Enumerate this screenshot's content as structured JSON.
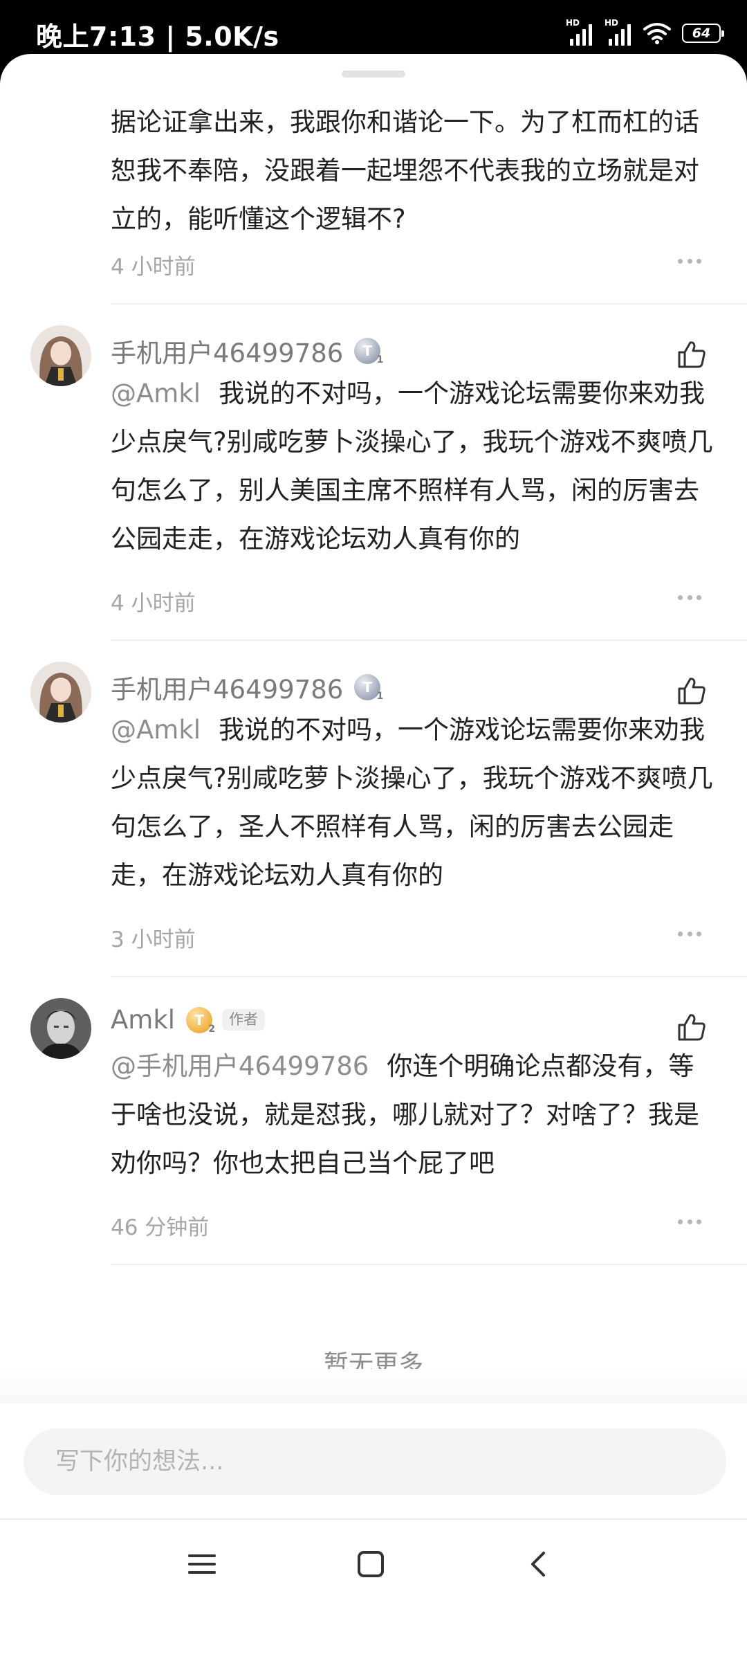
{
  "status_bar": {
    "time": "晚上7:13 | 5.0K/s",
    "signal_label_1": "HD",
    "signal_label_2": "HD",
    "battery": "64"
  },
  "comments": [
    {
      "text": "据论证拿出来，我跟你和谐论一下。为了杠而杠的话恕我不奉陪，没跟着一起埋怨不代表我的立场就是对立的，能听懂这个逻辑不?",
      "time": "4 小时前"
    },
    {
      "username": "手机用户46499786",
      "level_badge": "T",
      "level_sub": "1",
      "mention": "@Amkl",
      "text": "我说的不对吗，一个游戏论坛需要你来劝我少点戾气?别咸吃萝卜淡操心了，我玩个游戏不爽喷几句怎么了，别人美国主席不照样有人骂，闲的厉害去公园走走，在游戏论坛劝人真有你的",
      "time": "4 小时前"
    },
    {
      "username": "手机用户46499786",
      "level_badge": "T",
      "level_sub": "1",
      "mention": "@Amkl",
      "text": "我说的不对吗，一个游戏论坛需要你来劝我少点戾气?别咸吃萝卜淡操心了，我玩个游戏不爽喷几句怎么了，圣人不照样有人骂，闲的厉害去公园走走，在游戏论坛劝人真有你的",
      "time": "3 小时前"
    },
    {
      "username": "Amkl",
      "level_badge": "T",
      "level_sub": "2",
      "author_tag": "作者",
      "mention": "@手机用户46499786",
      "text": "你连个明确论点都没有，等于啥也没说，就是怼我，哪儿就对了？对啥了？我是劝你吗？你也太把自己当个屁了吧",
      "time": "46 分钟前"
    }
  ],
  "footer": {
    "no_more": "暂无更多"
  },
  "input": {
    "placeholder": "写下你的想法..."
  },
  "colors": {
    "level_silver": "#9ea7b8",
    "level_gold": "#f0b142"
  }
}
